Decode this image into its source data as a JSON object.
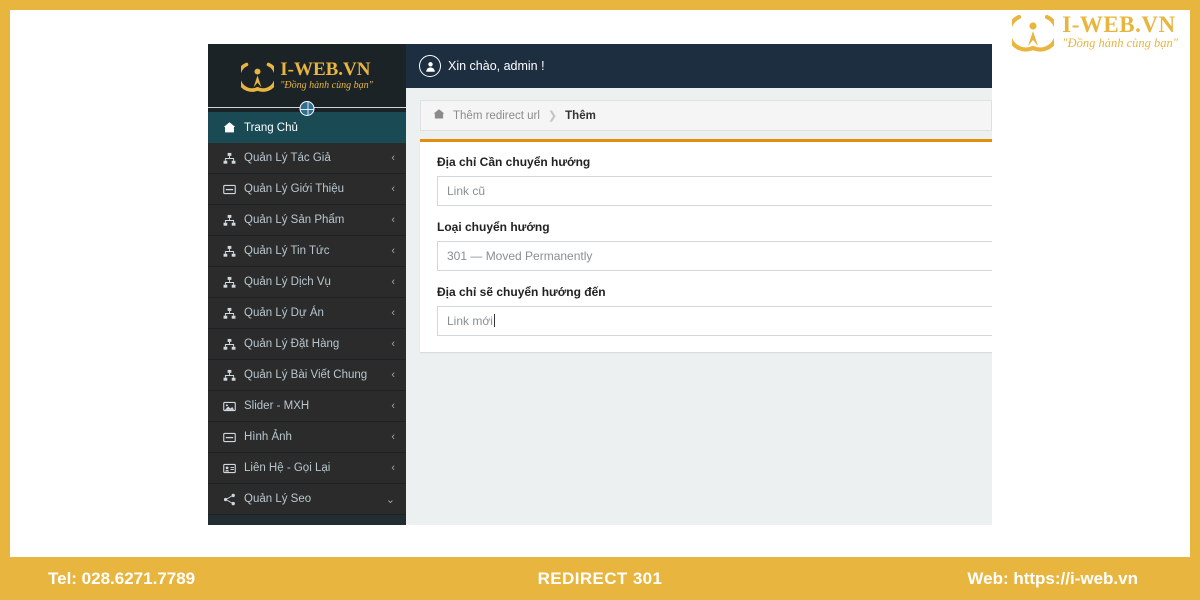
{
  "brand": {
    "name": "I-WEB.VN",
    "slogan": "\"Đồng hành cùng bạn\"",
    "mark_icon": "iweb-logo-icon"
  },
  "footer": {
    "tel": "Tel: 028.6271.7789",
    "title": "REDIRECT 301",
    "web": "Web: https://i-web.vn",
    "background": "#e8b53e"
  },
  "app": {
    "sidebar": {
      "logo": {
        "name": "I-WEB.VN",
        "slogan": "\"Đồng hành cùng bạn\"",
        "mark_icon": "iweb-logo-icon",
        "globe_icon": "globe-icon"
      },
      "active_color": "#1a4b55",
      "background": "#2b2b2b",
      "items": [
        {
          "label": "Trang Chủ",
          "icon": "home-icon",
          "caret": "",
          "active": true
        },
        {
          "label": "Quản Lý Tác Giả",
          "icon": "sitemap-icon",
          "caret": "‹",
          "active": false
        },
        {
          "label": "Quản Lý Giới Thiệu",
          "icon": "window-icon",
          "caret": "‹",
          "active": false
        },
        {
          "label": "Quản Lý Sản Phẩm",
          "icon": "sitemap-icon",
          "caret": "‹",
          "active": false
        },
        {
          "label": "Quản Lý Tin Tức",
          "icon": "sitemap-icon",
          "caret": "‹",
          "active": false
        },
        {
          "label": "Quản Lý Dịch Vụ",
          "icon": "sitemap-icon",
          "caret": "‹",
          "active": false
        },
        {
          "label": "Quản Lý Dự Án",
          "icon": "sitemap-icon",
          "caret": "‹",
          "active": false
        },
        {
          "label": "Quản Lý Đặt Hàng",
          "icon": "sitemap-icon",
          "caret": "‹",
          "active": false
        },
        {
          "label": "Quản Lý Bài Viết Chung",
          "icon": "sitemap-icon",
          "caret": "‹",
          "active": false
        },
        {
          "label": "Slider - MXH",
          "icon": "image-icon",
          "caret": "‹",
          "active": false
        },
        {
          "label": "Hình Ảnh",
          "icon": "window-icon",
          "caret": "‹",
          "active": false
        },
        {
          "label": "Liên Hệ - Gọi Lại",
          "icon": "id-card-icon",
          "caret": "‹",
          "active": false
        },
        {
          "label": "Quản Lý Seo",
          "icon": "share-icon",
          "caret": "⌄",
          "active": false
        }
      ]
    },
    "topbar": {
      "greeting": "Xin chào, admin !",
      "avatar_icon": "user-avatar-icon",
      "background": "#1c2e40"
    },
    "breadcrumb": {
      "home_icon": "home-icon",
      "parent": "Thêm redirect url",
      "separator": "❯",
      "current": "Thêm"
    },
    "form": {
      "accent_color": "#e08e0b",
      "fields": [
        {
          "label": "Địa chỉ Cần chuyển hướng",
          "value": "",
          "placeholder": "Link cũ",
          "type": "text"
        },
        {
          "label": "Loại chuyển hướng",
          "value": "301 — Moved Permanently",
          "placeholder": "301 — Moved Permanently",
          "type": "select"
        },
        {
          "label": "Địa chỉ sẽ chuyển hướng đến",
          "value": "",
          "placeholder": "Link mới",
          "type": "text"
        }
      ]
    }
  }
}
